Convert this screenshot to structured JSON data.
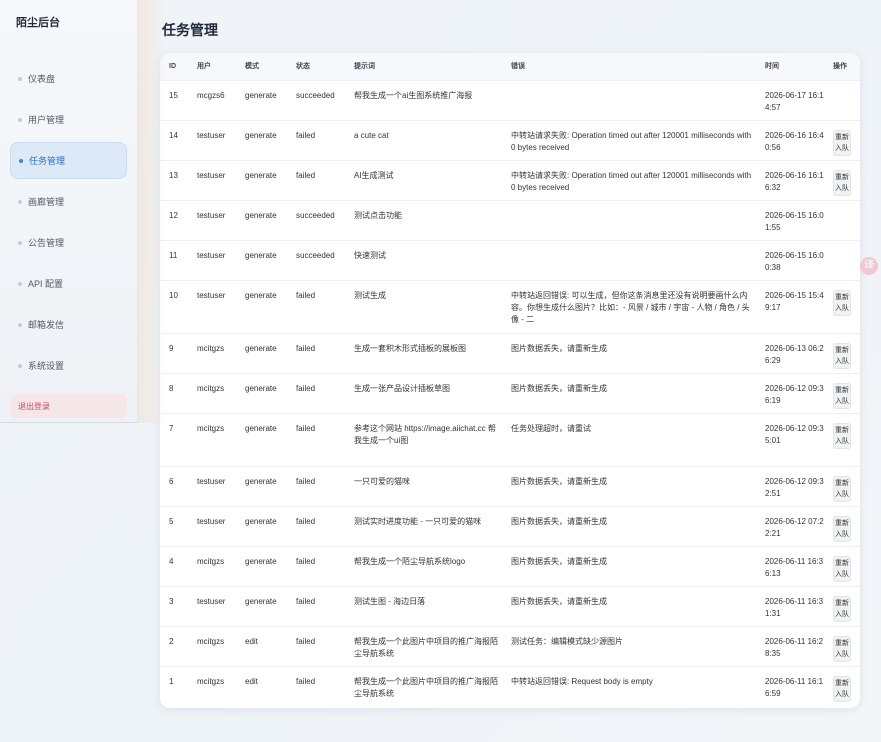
{
  "app": {
    "brand": "陌尘后台",
    "page_title": "任务管理"
  },
  "sidebar": {
    "items": [
      {
        "label": "仪表盘"
      },
      {
        "label": "用户管理"
      },
      {
        "label": "任务管理"
      },
      {
        "label": "画廊管理"
      },
      {
        "label": "公告管理"
      },
      {
        "label": "API 配置"
      },
      {
        "label": "邮箱发信"
      },
      {
        "label": "系统设置"
      }
    ],
    "active_index": 2,
    "logout": "退出登录"
  },
  "table": {
    "columns": [
      "ID",
      "用户",
      "模式",
      "状态",
      "提示词",
      "错误",
      "时间",
      "操作"
    ],
    "requeue_label": "重新入队",
    "rows": [
      {
        "id": "15",
        "user": "mcgzs6",
        "mode": "generate",
        "status": "succeeded",
        "prompt": "帮我生成一个ai生图系统推广海报",
        "error": "",
        "time": "2026-06-17 16:14:57",
        "action": ""
      },
      {
        "id": "14",
        "user": "testuser",
        "mode": "generate",
        "status": "failed",
        "prompt": "a cute cat",
        "error": "中转站请求失败: Operation timed out after 120001 milliseconds with 0 bytes received",
        "time": "2026-06-16 16:40:56",
        "action": "重新入队"
      },
      {
        "id": "13",
        "user": "testuser",
        "mode": "generate",
        "status": "failed",
        "prompt": "AI生成测试",
        "error": "中转站请求失败: Operation timed out after 120001 milliseconds with 0 bytes received",
        "time": "2026-06-16 16:16:32",
        "action": "重新入队"
      },
      {
        "id": "12",
        "user": "testuser",
        "mode": "generate",
        "status": "succeeded",
        "prompt": "测试点击功能",
        "error": "",
        "time": "2026-06-15 16:01:55",
        "action": ""
      },
      {
        "id": "11",
        "user": "testuser",
        "mode": "generate",
        "status": "succeeded",
        "prompt": "快速测试",
        "error": "",
        "time": "2026-06-15 16:00:38",
        "action": ""
      },
      {
        "id": "10",
        "user": "testuser",
        "mode": "generate",
        "status": "failed",
        "prompt": "测试生成",
        "error": "中转站返回错误: 可以生成，但你这条消息里还没有说明要画什么内容。你想生成什么图片？比如：- 风景 / 城市 / 宇宙 - 人物 / 角色 / 头像 - 二",
        "time": "2026-06-15 15:49:17",
        "action": "重新入队"
      },
      {
        "id": "9",
        "user": "mcitgzs",
        "mode": "generate",
        "status": "failed",
        "prompt": "生成一套积木形式插板的展板图",
        "error": "图片数据丢失，请重新生成",
        "time": "2026-06-13 06:26:29",
        "action": "重新入队"
      },
      {
        "id": "8",
        "user": "mcitgzs",
        "mode": "generate",
        "status": "failed",
        "prompt": "生成一张产品设计插板草图",
        "error": "图片数据丢失，请重新生成",
        "time": "2026-06-12 09:36:19",
        "action": "重新入队"
      },
      {
        "id": "7",
        "user": "mcitgzs",
        "mode": "generate",
        "status": "failed",
        "prompt": "参考这个网站 https://image.aiichat.cc 帮我生成一个ui图",
        "error": "任务处理超时，请重试",
        "time": "2026-06-12 09:35:01",
        "action": "重新入队"
      },
      {
        "id": "6",
        "user": "testuser",
        "mode": "generate",
        "status": "failed",
        "prompt": "一只可爱的猫咪",
        "error": "图片数据丢失，请重新生成",
        "time": "2026-06-12 09:32:51",
        "action": "重新入队"
      },
      {
        "id": "5",
        "user": "testuser",
        "mode": "generate",
        "status": "failed",
        "prompt": "测试实时进度功能 - 一只可爱的猫咪",
        "error": "图片数据丢失，请重新生成",
        "time": "2026-06-12 07:22:21",
        "action": "重新入队"
      },
      {
        "id": "4",
        "user": "mcitgzs",
        "mode": "generate",
        "status": "failed",
        "prompt": "帮我生成一个陌尘导航系统logo",
        "error": "图片数据丢失，请重新生成",
        "time": "2026-06-11 16:36:13",
        "action": "重新入队"
      },
      {
        "id": "3",
        "user": "testuser",
        "mode": "generate",
        "status": "failed",
        "prompt": "测试生图 - 海边日落",
        "error": "图片数据丢失，请重新生成",
        "time": "2026-06-11 16:31:31",
        "action": "重新入队"
      },
      {
        "id": "2",
        "user": "mcitgzs",
        "mode": "edit",
        "status": "failed",
        "prompt": "帮我生成一个此图片中项目的推广海报陌尘导航系统",
        "error": "测试任务：编辑模式缺少源图片",
        "time": "2026-06-11 16:28:35",
        "action": "重新入队"
      },
      {
        "id": "1",
        "user": "mcitgzs",
        "mode": "edit",
        "status": "failed",
        "prompt": "帮我生成一个此图片中项目的推广海报陌尘导航系统",
        "error": "中转站返回错误: Request body is empty",
        "time": "2026-06-11 16:16:59",
        "action": "重新入队"
      }
    ]
  },
  "float_button": {
    "label": "译"
  }
}
